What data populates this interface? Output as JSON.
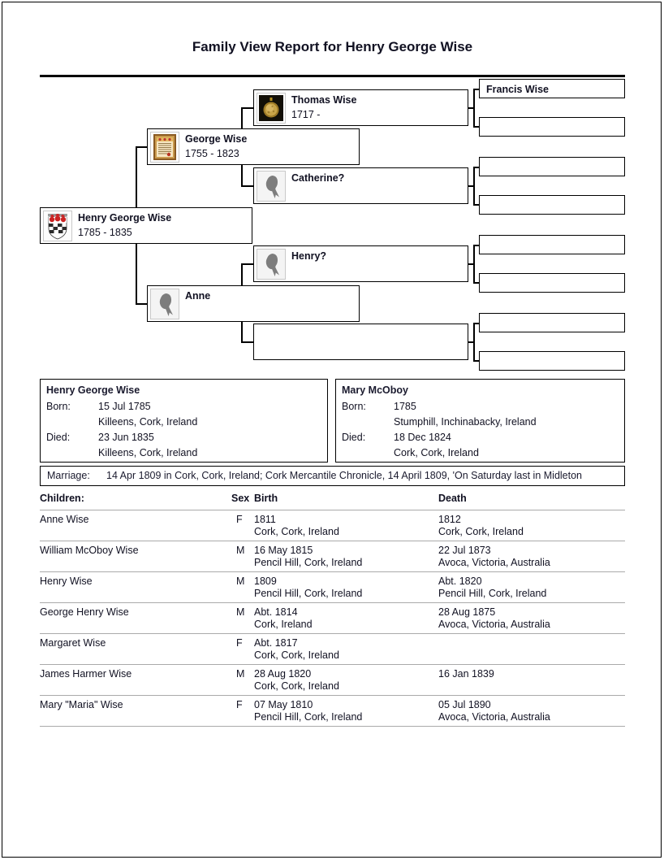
{
  "report": {
    "title": "Family View Report for Henry George Wise"
  },
  "tree": {
    "nodes": [
      {
        "id": "henry-george-wise",
        "name": "Henry George Wise",
        "dates": "1785 - 1835",
        "image": "coat-of-arms-thumbnail"
      },
      {
        "id": "george-wise",
        "name": "George Wise",
        "dates": "1755 - 1823",
        "image": "framed-certificate-thumbnail"
      },
      {
        "id": "anne",
        "name": "Anne",
        "dates": "",
        "image": "silhouette-thumbnail"
      },
      {
        "id": "thomas-wise",
        "name": "Thomas Wise",
        "dates": "1717 -",
        "image": "gold-medal-thumbnail"
      },
      {
        "id": "catherine",
        "name": "Catherine?",
        "dates": "",
        "image": "silhouette-thumbnail"
      },
      {
        "id": "henry-q",
        "name": "Henry?",
        "dates": "",
        "image": "silhouette-thumbnail"
      },
      {
        "id": "anne-spouse-unknown",
        "name": "",
        "dates": "",
        "image": ""
      },
      {
        "id": "francis-wise",
        "name": "Francis Wise",
        "dates": "",
        "image": ""
      },
      {
        "id": "gg-2",
        "name": "",
        "dates": "",
        "image": ""
      },
      {
        "id": "gg-3",
        "name": "",
        "dates": "",
        "image": ""
      },
      {
        "id": "gg-4",
        "name": "",
        "dates": "",
        "image": ""
      },
      {
        "id": "gg-5",
        "name": "",
        "dates": "",
        "image": ""
      },
      {
        "id": "gg-6",
        "name": "",
        "dates": "",
        "image": ""
      },
      {
        "id": "gg-7",
        "name": "",
        "dates": "",
        "image": ""
      },
      {
        "id": "gg-8",
        "name": "",
        "dates": "",
        "image": ""
      }
    ]
  },
  "primary": {
    "name": "Henry George Wise",
    "born_label": "Born:",
    "born_date": "15 Jul 1785",
    "born_place": "Killeens, Cork, Ireland",
    "died_label": "Died:",
    "died_date": "23 Jun 1835",
    "died_place": "Killeens, Cork, Ireland"
  },
  "spouse": {
    "name": "Mary McOboy",
    "born_label": "Born:",
    "born_date": "1785",
    "born_place": "Stumphill, Inchinabacky, Ireland",
    "died_label": "Died:",
    "died_date": "18 Dec 1824",
    "died_place": "Cork, Cork, Ireland"
  },
  "marriage": {
    "label": "Marriage:",
    "text": "14 Apr 1809 in Cork, Cork, Ireland; Cork Mercantile Chronicle, 14 April 1809, 'On Saturday last in Midleton"
  },
  "children": {
    "headers": {
      "name": "Children:",
      "sex": "Sex",
      "birth": "Birth",
      "death": "Death"
    },
    "rows": [
      {
        "name": "Anne Wise",
        "sex": "F",
        "birth_date": "1811",
        "birth_place": "Cork, Cork, Ireland",
        "death_date": "1812",
        "death_place": "Cork, Cork, Ireland"
      },
      {
        "name": "William McOboy Wise",
        "sex": "M",
        "birth_date": "16 May 1815",
        "birth_place": "Pencil Hill, Cork, Ireland",
        "death_date": "22 Jul 1873",
        "death_place": "Avoca, Victoria, Australia"
      },
      {
        "name": "Henry Wise",
        "sex": "M",
        "birth_date": "1809",
        "birth_place": "Pencil Hill, Cork, Ireland",
        "death_date": "Abt. 1820",
        "death_place": "Pencil Hill, Cork, Ireland"
      },
      {
        "name": "George Henry Wise",
        "sex": "M",
        "birth_date": "Abt. 1814",
        "birth_place": "Cork, Ireland",
        "death_date": "28 Aug 1875",
        "death_place": "Avoca, Victoria, Australia"
      },
      {
        "name": "Margaret Wise",
        "sex": "F",
        "birth_date": "Abt. 1817",
        "birth_place": "Cork, Cork, Ireland",
        "death_date": "",
        "death_place": ""
      },
      {
        "name": "James Harmer Wise",
        "sex": "M",
        "birth_date": "28 Aug 1820",
        "birth_place": "Cork, Cork, Ireland",
        "death_date": "16 Jan 1839",
        "death_place": ""
      },
      {
        "name": "Mary \"Maria\" Wise",
        "sex": "F",
        "birth_date": "07 May 1810",
        "birth_place": "Pencil Hill, Cork, Ireland",
        "death_date": "05 Jul 1890",
        "death_place": "Avoca, Victoria, Australia"
      }
    ]
  },
  "colors": {
    "text": "#111122",
    "border": "#000000",
    "rule": "#aaaaaa"
  }
}
